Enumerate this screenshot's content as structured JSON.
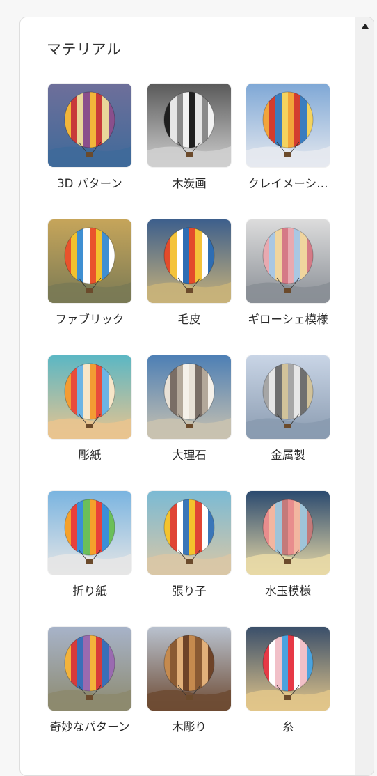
{
  "section": {
    "title": "マテリアル"
  },
  "materials": [
    {
      "label": "3D パターン",
      "sky": "#6e6f9a",
      "ground": "#3f6a9a",
      "stripes": [
        "#f2b63a",
        "#c83a3a",
        "#e9d79a",
        "#8a4f8c"
      ]
    },
    {
      "label": "木炭画",
      "sky": "#5a5a5a",
      "ground": "#cfcfcf",
      "stripes": [
        "#1f1f1f",
        "#e6e6e6",
        "#8a8a8a",
        "#f2f2f2"
      ]
    },
    {
      "label": "クレイメーシ…",
      "sky": "#7fa8d6",
      "ground": "#e6e9ef",
      "stripes": [
        "#f2a43a",
        "#d33c2f",
        "#3a7dbf",
        "#f4d35e"
      ]
    },
    {
      "label": "ファブリック",
      "sky": "#c6a55a",
      "ground": "#7a7a55",
      "stripes": [
        "#e9522c",
        "#f2c12e",
        "#3f8fd2",
        "#ffffff"
      ]
    },
    {
      "label": "毛皮",
      "sky": "#3d5f8c",
      "ground": "#c8b27a",
      "stripes": [
        "#e34b2b",
        "#f4c33a",
        "#ffffff",
        "#2e6db3"
      ]
    },
    {
      "label": "ギローシェ模様",
      "sky": "#dcdcdc",
      "ground": "#8a8f96",
      "stripes": [
        "#e8a9b0",
        "#a9c7e3",
        "#f0d59e",
        "#d57a86"
      ]
    },
    {
      "label": "彫紙",
      "sky": "#5bb7c4",
      "ground": "#e9c48f",
      "stripes": [
        "#f39c33",
        "#e94c3c",
        "#6cb4e4",
        "#f7e6c8"
      ]
    },
    {
      "label": "大理石",
      "sky": "#4d7fb5",
      "ground": "#c9c2b0",
      "stripes": [
        "#e8e1d6",
        "#7a6e66",
        "#b3a89a",
        "#f5f1ea"
      ]
    },
    {
      "label": "金属製",
      "sky": "#c9d5e6",
      "ground": "#8a9bb0",
      "stripes": [
        "#a6a6a6",
        "#e6e6e6",
        "#6f6f6f",
        "#d1c29a"
      ]
    },
    {
      "label": "折り紙",
      "sky": "#7ab4e0",
      "ground": "#e6e6e6",
      "stripes": [
        "#f5a12b",
        "#e9403a",
        "#3a8fd8",
        "#6bbf59"
      ]
    },
    {
      "label": "張り子",
      "sky": "#7bbad4",
      "ground": "#d9c7a6",
      "stripes": [
        "#f4c32c",
        "#e04535",
        "#ffffff",
        "#3a76b8"
      ]
    },
    {
      "label": "水玉模様",
      "sky": "#2b4a6f",
      "ground": "#e8d9a6",
      "stripes": [
        "#e88d8d",
        "#f2b6a0",
        "#9fc4d9",
        "#c47a7a"
      ]
    },
    {
      "label": "奇妙なパターン",
      "sky": "#a7b3c9",
      "ground": "#8d8a6e",
      "stripes": [
        "#f3b33b",
        "#d83a3a",
        "#3a6fb8",
        "#9a6ab0"
      ]
    },
    {
      "label": "木彫り",
      "sky": "#b9c2cf",
      "ground": "#6e4b33",
      "stripes": [
        "#c58a4e",
        "#8a5a33",
        "#e2b07a",
        "#6e4328"
      ]
    },
    {
      "label": "糸",
      "sky": "#3a4f6a",
      "ground": "#e1c58a",
      "stripes": [
        "#e63946",
        "#ffffff",
        "#f1c0c8",
        "#4aa3df"
      ]
    }
  ]
}
